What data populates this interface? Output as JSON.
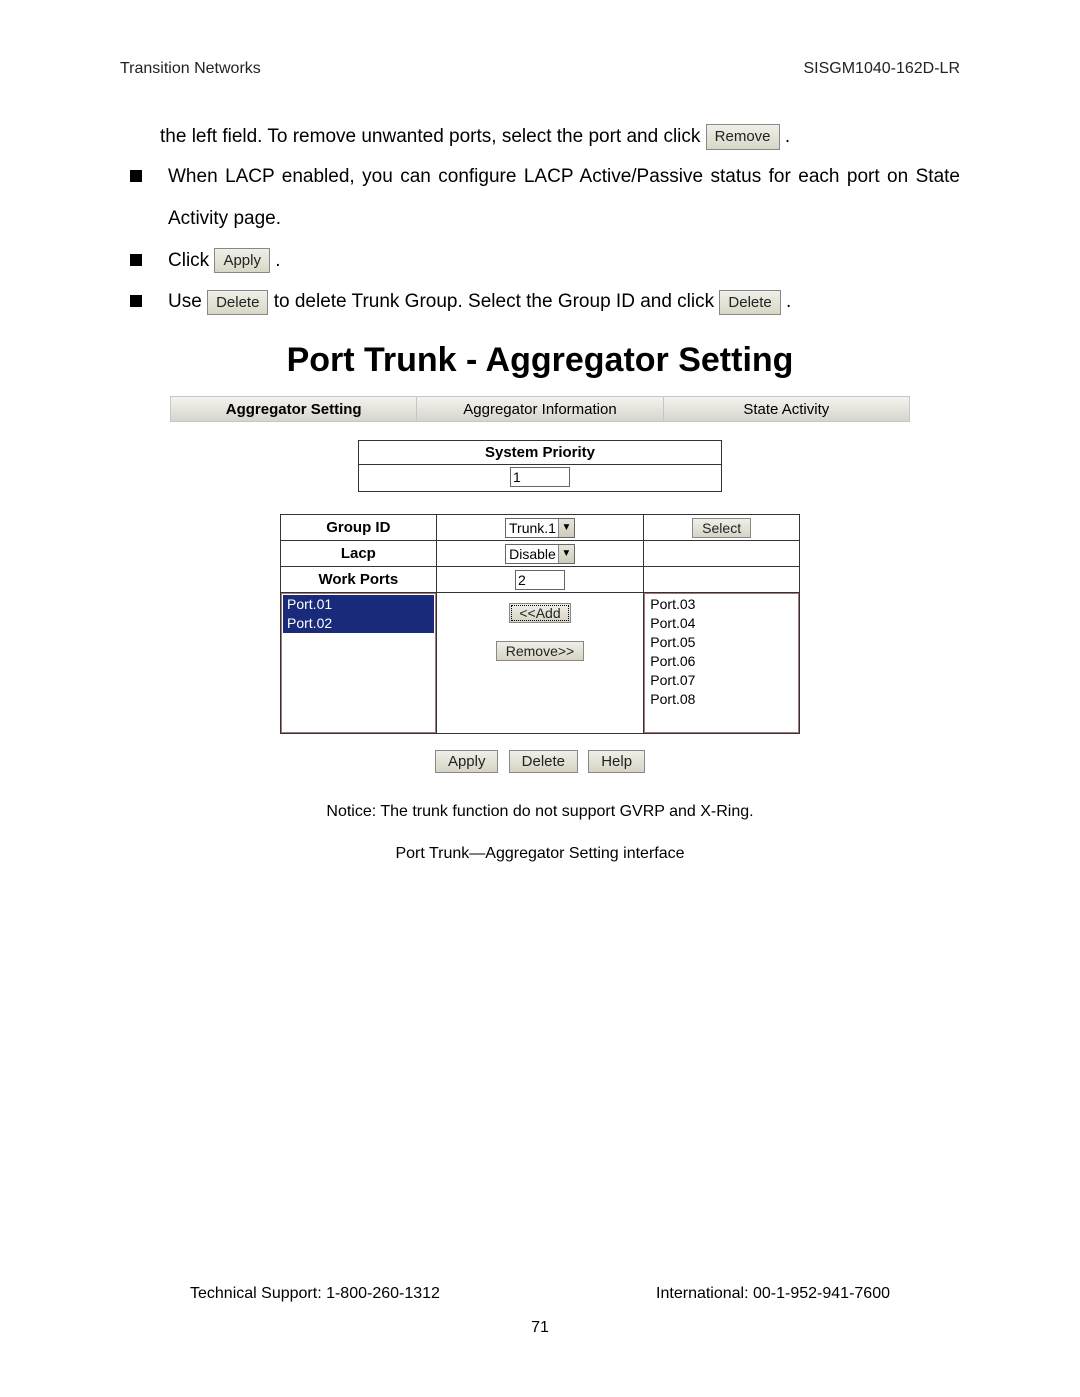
{
  "header": {
    "left": "Transition Networks",
    "right": "SISGM1040-162D-LR"
  },
  "para1_pre": "the left field. To remove unwanted ports, select the port and click ",
  "remove_inline": "Remove",
  "para1_post": " .",
  "bullets": {
    "lacp": "When LACP enabled, you can configure LACP Active/Passive status for each port on State Activity page.",
    "click_pre": "Click ",
    "apply_inline": "Apply",
    "click_post": " .",
    "use_pre": "Use ",
    "delete_inline1": "Delete",
    "use_mid": " to delete Trunk Group. Select the Group ID and click ",
    "delete_inline2": "Delete",
    "use_post": " ."
  },
  "title": "Port Trunk - Aggregator Setting",
  "tabs": {
    "t0": "Aggregator Setting",
    "t1": "Aggregator Information",
    "t2": "State Activity"
  },
  "syspri": {
    "label": "System Priority",
    "value": "1"
  },
  "rows": {
    "group_id_label": "Group ID",
    "group_id_value": "Trunk.1",
    "select_btn": "Select",
    "lacp_label": "Lacp",
    "lacp_value": "Disable",
    "workports_label": "Work Ports",
    "workports_value": "2"
  },
  "ports_left": {
    "p0": "Port.01",
    "p1": "Port.02"
  },
  "ports_right": {
    "p0": "Port.03",
    "p1": "Port.04",
    "p2": "Port.05",
    "p3": "Port.06",
    "p4": "Port.07",
    "p5": "Port.08"
  },
  "add_btn": "<<Add",
  "remove_btn": "Remove>>",
  "apply_btn": "Apply",
  "delete_btn": "Delete",
  "help_btn": "Help",
  "notice": "Notice: The trunk function do not support GVRP and X-Ring.",
  "caption": "Port Trunk—Aggregator Setting interface",
  "footer": {
    "left": "Technical Support: 1-800-260-1312",
    "right": "International: 00-1-952-941-7600",
    "page": "71"
  }
}
